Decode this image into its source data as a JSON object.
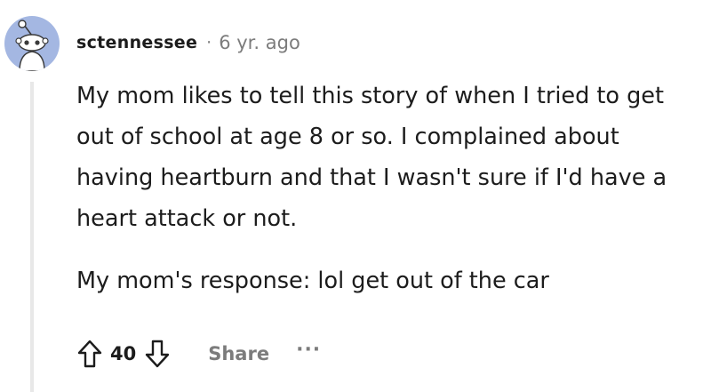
{
  "comment": {
    "author": "sctennessee",
    "separator": "·",
    "age": "6 yr. ago",
    "paragraphs": [
      "My mom likes to tell this story of when I tried to get out of school at age 8 or so. I complained about having heartburn and that I wasn't sure if I'd have a heart attack or not.",
      "My mom's response: lol get out of the car"
    ],
    "score": "40",
    "share_label": "Share",
    "more_label": "···"
  },
  "icons": {
    "avatar": "snoo-avatar-icon",
    "upvote": "upvote-arrow-icon",
    "downvote": "downvote-arrow-icon"
  },
  "colors": {
    "avatar_bg": "#a4b7e2",
    "text": "#1c1c1c",
    "muted": "#7c7c7c",
    "thread_line": "#e8e8e8"
  }
}
